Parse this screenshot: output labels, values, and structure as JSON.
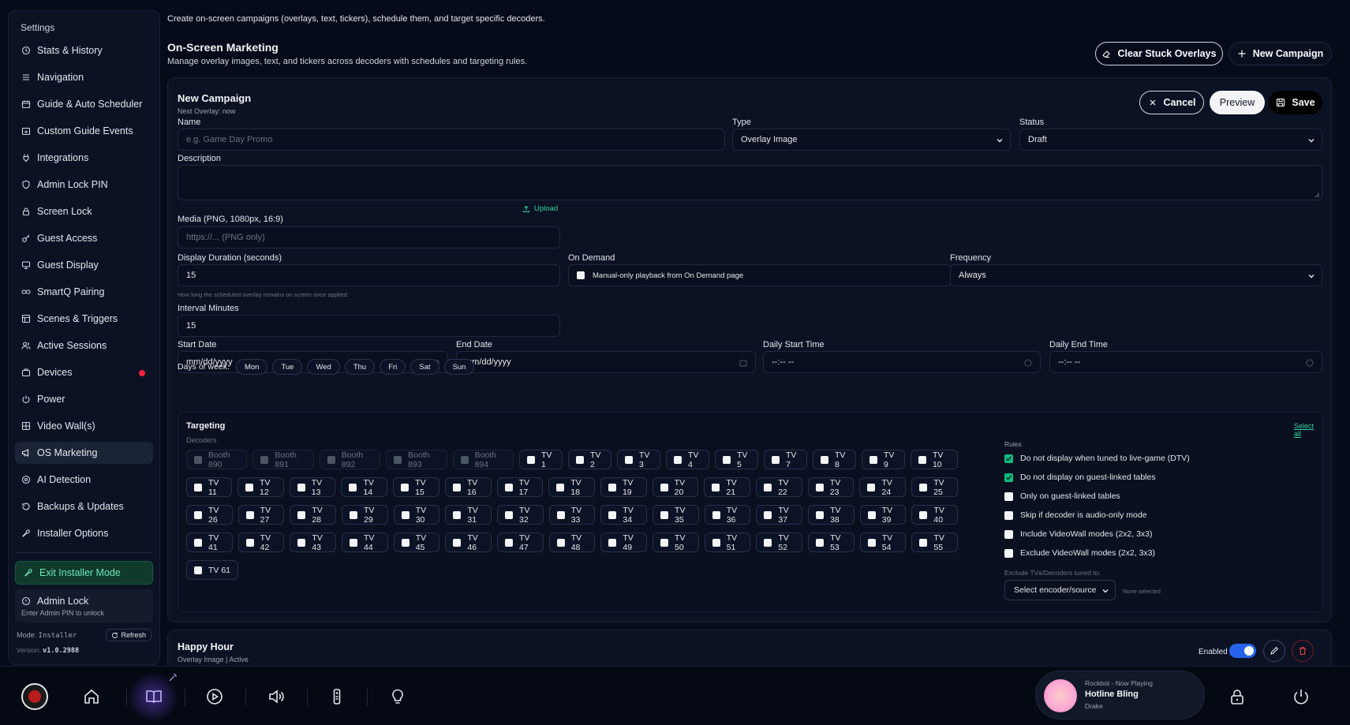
{
  "sidebar": {
    "title": "Settings",
    "items": [
      {
        "label": "Stats & History",
        "icon": "history-icon"
      },
      {
        "label": "Navigation",
        "icon": "list-icon"
      },
      {
        "label": "Guide & Auto Scheduler",
        "icon": "calendar-icon"
      },
      {
        "label": "Custom Guide Events",
        "icon": "calendar-plus-icon"
      },
      {
        "label": "Integrations",
        "icon": "plug-icon"
      },
      {
        "label": "Admin Lock PIN",
        "icon": "shield-icon"
      },
      {
        "label": "Screen Lock",
        "icon": "lock-icon"
      },
      {
        "label": "Guest Access",
        "icon": "key-icon"
      },
      {
        "label": "Guest Display",
        "icon": "monitor-icon"
      },
      {
        "label": "SmartQ Pairing",
        "icon": "link-icon"
      },
      {
        "label": "Scenes & Triggers",
        "icon": "layers-icon"
      },
      {
        "label": "Active Sessions",
        "icon": "users-icon"
      },
      {
        "label": "Devices",
        "icon": "box-icon"
      },
      {
        "label": "Power",
        "icon": "power-icon"
      },
      {
        "label": "Video Wall(s)",
        "icon": "grid-icon"
      },
      {
        "label": "OS Marketing",
        "icon": "megaphone-icon"
      },
      {
        "label": "AI Detection",
        "icon": "target-icon"
      },
      {
        "label": "Backups & Updates",
        "icon": "history-icon"
      },
      {
        "label": "Installer Options",
        "icon": "wrench-icon"
      }
    ],
    "exit_label": "Exit Installer Mode",
    "admin_lock_label": "Admin Lock",
    "admin_lock_sub": "Enter Admin PIN to unlock",
    "mode_label": "Mode:",
    "mode_value": "Installer",
    "refresh_label": "Refresh",
    "version_label": "Version:",
    "version_value": "v1.0.2988"
  },
  "page": {
    "intro": "Create on-screen campaigns (overlays, text, tickers), schedule them, and target specific decoders.",
    "title": "On-Screen Marketing",
    "subtitle": "Manage overlay images, text, and tickers across decoders with schedules and targeting rules.",
    "clear_label": "Clear Stuck Overlays",
    "new_label": "New Campaign"
  },
  "form": {
    "title": "New Campaign",
    "next_overlay": "Next Overlay: now",
    "cancel_label": "Cancel",
    "preview_label": "Preview",
    "save_label": "Save",
    "name_label": "Name",
    "name_placeholder": "e.g. Game Day Promo",
    "type_label": "Type",
    "type_value": "Overlay Image",
    "status_label": "Status",
    "status_value": "Draft",
    "description_label": "Description",
    "media_label": "Media (PNG, 1080px, 16:9)",
    "upload_label": "Upload",
    "media_placeholder": "https://... (PNG only)",
    "duration_label": "Display Duration (seconds)",
    "duration_value": "15",
    "duration_help": "How long the scheduled overlay remains on screen once applied.",
    "ondemand_label": "On Demand",
    "ondemand_text": "Manual-only playback from On Demand page",
    "frequency_label": "Frequency",
    "frequency_value": "Always",
    "interval_label": "Interval Minutes",
    "interval_value": "15",
    "start_date_label": "Start Date",
    "start_date_value": "mm/dd/yyyy",
    "end_date_label": "End Date",
    "end_date_value": "mm/dd/yyyy",
    "daily_start_label": "Daily Start Time",
    "daily_start_value": "--:-- --",
    "daily_end_label": "Daily End Time",
    "daily_end_value": "--:-- --",
    "days_label": "Days of week:",
    "days": [
      "Mon",
      "Tue",
      "Wed",
      "Thu",
      "Fri",
      "Sat",
      "Sun"
    ]
  },
  "targeting": {
    "title": "Targeting",
    "decoders_label": "Decoders",
    "select_all": "Select all",
    "decoder_rows": [
      [
        "Booth 890",
        "Booth 891",
        "Booth 892",
        "Booth 893",
        "Booth 894",
        "TV 1",
        "TV 2",
        "TV 3",
        "TV 4",
        "TV 5",
        "TV 7",
        "TV 8",
        "TV 9",
        "TV 10"
      ],
      [
        "TV 11",
        "TV 12",
        "TV 13",
        "TV 14",
        "TV 15",
        "TV 16",
        "TV 17",
        "TV 18",
        "TV 19",
        "TV 20",
        "TV 21",
        "TV 22",
        "TV 23",
        "TV 24",
        "TV 25"
      ],
      [
        "TV 26",
        "TV 27",
        "TV 28",
        "TV 29",
        "TV 30",
        "TV 31",
        "TV 32",
        "TV 33",
        "TV 34",
        "TV 35",
        "TV 36",
        "TV 37",
        "TV 38",
        "TV 39",
        "TV 40"
      ],
      [
        "TV 41",
        "TV 42",
        "TV 43",
        "TV 44",
        "TV 45",
        "TV 46",
        "TV 47",
        "TV 48",
        "TV 49",
        "TV 50",
        "TV 51",
        "TV 52",
        "TV 53",
        "TV 54",
        "TV 55"
      ],
      [
        "TV 61"
      ]
    ],
    "rules_label": "Rules",
    "rules": [
      {
        "label": "Do not display when tuned to live-game (DTV)",
        "checked": true
      },
      {
        "label": "Do not display on guest-linked tables",
        "checked": true
      },
      {
        "label": "Only on guest-linked tables",
        "checked": false
      },
      {
        "label": "Skip if decoder is audio-only mode",
        "checked": false
      },
      {
        "label": "Include VideoWall modes (2x2, 3x3)",
        "checked": false
      },
      {
        "label": "Exclude VideoWall modes (2x2, 3x3)",
        "checked": false
      }
    ],
    "exclude_label": "Exclude TVs/Decoders tuned to:",
    "exclude_select": "Select encoder/source",
    "none_selected": "None selected"
  },
  "campaign2": {
    "title": "Happy Hour",
    "subtitle": "Overlay Image | Active",
    "enabled_label": "Enabled"
  },
  "now_playing": {
    "source": "Rockbot - Now Playing",
    "track": "Hotline Bling",
    "artist": "Drake"
  },
  "colors": {
    "background": "#060b1a",
    "accent_green": "#34d399",
    "toggle_blue": "#2563eb",
    "alert_red": "#ef233c"
  }
}
